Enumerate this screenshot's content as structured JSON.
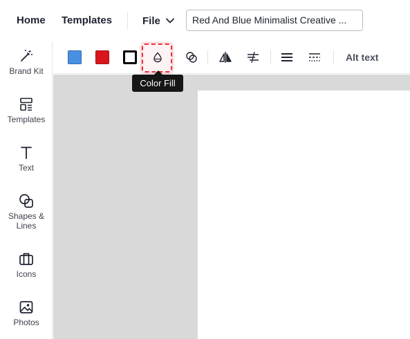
{
  "header": {
    "home_label": "Home",
    "templates_label": "Templates",
    "file_label": "File",
    "document_title": "Red And Blue Minimalist Creative ..."
  },
  "sidebar": {
    "items": [
      {
        "label": "Brand Kit",
        "icon": "magic-wand-icon"
      },
      {
        "label": "Templates",
        "icon": "templates-icon"
      },
      {
        "label": "Text",
        "icon": "text-icon"
      },
      {
        "label": "Shapes & Lines",
        "icon": "shapes-icon"
      },
      {
        "label": "Icons",
        "icon": "briefcase-icon"
      },
      {
        "label": "Photos",
        "icon": "image-icon"
      }
    ]
  },
  "toolbar": {
    "swatch_colors": [
      "#4a90e2",
      "#d9161c",
      "#000000"
    ],
    "alt_text_label": "Alt text",
    "tooltip": "Color Fill"
  }
}
